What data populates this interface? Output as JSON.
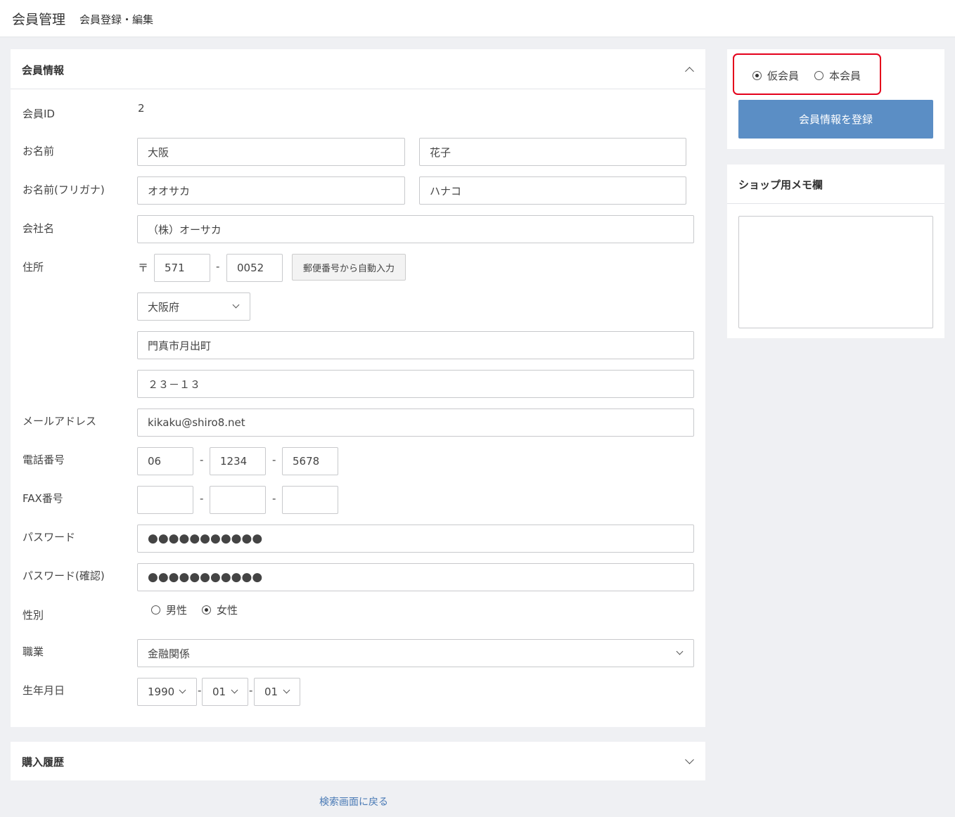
{
  "header": {
    "title": "会員管理",
    "subtitle": "会員登録・編集"
  },
  "member_card": {
    "heading": "会員情報",
    "id_label": "会員ID",
    "id_value": "2",
    "name_label": "お名前",
    "last_name": "大阪",
    "first_name": "花子",
    "kana_label": "お名前(フリガナ)",
    "last_kana": "オオサカ",
    "first_kana": "ハナコ",
    "company_label": "会社名",
    "company": "（株）オーサカ",
    "address_label": "住所",
    "zip_mark": "〒",
    "zip1": "571",
    "zip2": "0052",
    "zip_sep": "-",
    "zip_button": "郵便番号から自動入力",
    "prefecture": "大阪府",
    "address1": "門真市月出町",
    "address2": "２３－１３",
    "email_label": "メールアドレス",
    "email": "kikaku@shiro8.net",
    "phone_label": "電話番号",
    "phone1": "06",
    "phone2": "1234",
    "phone3": "5678",
    "phone_sep": "-",
    "fax_label": "FAX番号",
    "fax1": "",
    "fax2": "",
    "fax3": "",
    "password_label": "パスワード",
    "password": "●●●●●●●●●●●",
    "password_confirm_label": "パスワード(確認)",
    "password_confirm": "●●●●●●●●●●●",
    "gender_label": "性別",
    "gender_options": [
      "男性",
      "女性"
    ],
    "gender_selected": "女性",
    "job_label": "職業",
    "job": "金融関係",
    "birth_label": "生年月日",
    "birth_year": "1990",
    "birth_month": "01",
    "birth_day": "01",
    "birth_sep": "-"
  },
  "purchase_card": {
    "heading": "購入履歴"
  },
  "status_card": {
    "options": [
      "仮会員",
      "本会員"
    ],
    "selected": "仮会員",
    "register_button": "会員情報を登録",
    "highlight_color": "#e4001b",
    "button_color": "#5b8ec5"
  },
  "memo_card": {
    "heading": "ショップ用メモ欄"
  },
  "footer": {
    "back_link": "検索画面に戻る"
  }
}
